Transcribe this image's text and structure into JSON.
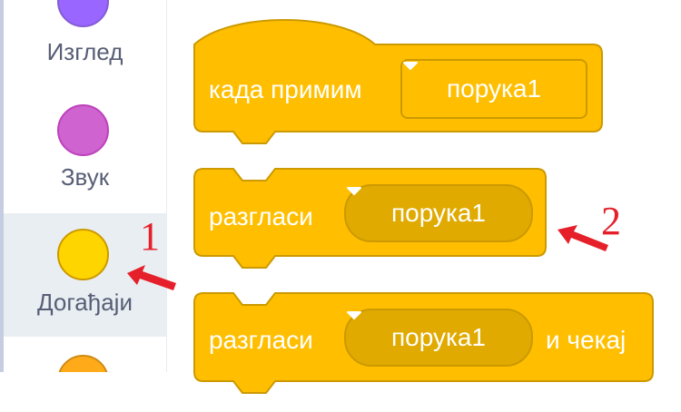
{
  "sidebar": {
    "categories": [
      {
        "label": "Изглед",
        "color": "#9966ff",
        "border": "#855cd6"
      },
      {
        "label": "Звук",
        "color": "#cf63cf",
        "border": "#bd42bd"
      },
      {
        "label": "Догађаји",
        "color": "#ffd500",
        "border": "#cc9900",
        "selected": true
      },
      {
        "label": "",
        "color": "#ffab19",
        "border": "#cf8b17"
      }
    ]
  },
  "blocks": {
    "when_receive": {
      "label": "када примим",
      "message": "порука1"
    },
    "broadcast": {
      "label": "разгласи",
      "message": "порука1"
    },
    "broadcast_wait": {
      "label": "разгласи",
      "message": "порука1",
      "suffix": "и чекај"
    }
  },
  "annotations": {
    "one": "1",
    "two": "2",
    "color": "#e5202a"
  },
  "colors": {
    "event_block": "#ffbf00",
    "event_block_border": "#cc9900"
  }
}
